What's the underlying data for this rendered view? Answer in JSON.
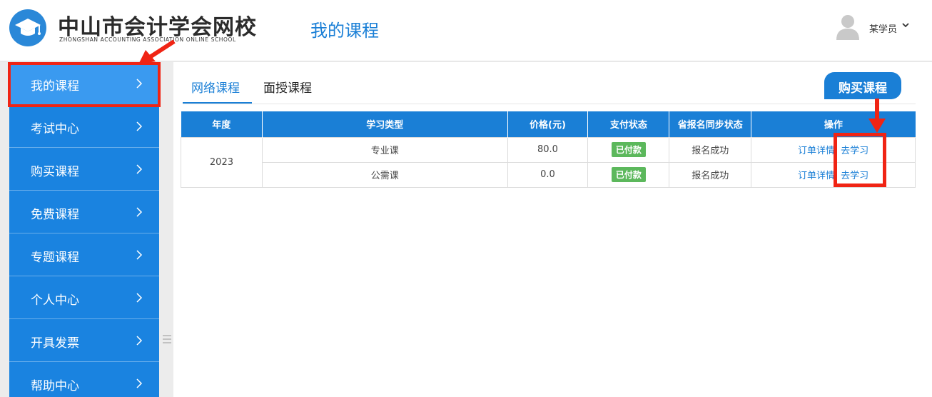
{
  "header": {
    "logo_cn": "中山市会计学会网校",
    "logo_en": "ZHONGSHAN ACCOUNTING ASSOCIATION ONLINE SCHOOL",
    "page_title": "我的课程",
    "user_name": "某学员",
    "user_chevron": "⌄"
  },
  "sidebar": {
    "items": [
      {
        "label": "我的课程",
        "active": true
      },
      {
        "label": "考试中心"
      },
      {
        "label": "购买课程"
      },
      {
        "label": "免费课程"
      },
      {
        "label": "专题课程"
      },
      {
        "label": "个人中心"
      },
      {
        "label": "开具发票"
      },
      {
        "label": "帮助中心"
      }
    ]
  },
  "tabs": [
    {
      "label": "网络课程",
      "active": true
    },
    {
      "label": "面授课程"
    }
  ],
  "buy_button": "购买课程",
  "table": {
    "headers": [
      "年度",
      "学习类型",
      "价格(元)",
      "支付状态",
      "省报名同步状态",
      "操作"
    ],
    "year": "2023",
    "rows": [
      {
        "type": "专业课",
        "price": "80.0",
        "pay_status": "已付款",
        "sync_status": "报名成功",
        "detail": "订单详情",
        "study": "去学习"
      },
      {
        "type": "公需课",
        "price": "0.0",
        "pay_status": "已付款",
        "sync_status": "报名成功",
        "detail": "订单详情",
        "study": "去学习"
      }
    ]
  },
  "colors": {
    "brand_blue": "#1a7fd6",
    "sidebar_blue": "#1a83e0",
    "paid_green": "#5cb85c",
    "annotation_red": "#f02414"
  },
  "icons": [
    "graduation-cap-icon",
    "avatar-icon",
    "chevron-right-icon",
    "chevron-down-icon",
    "collapse-handle-icon"
  ]
}
